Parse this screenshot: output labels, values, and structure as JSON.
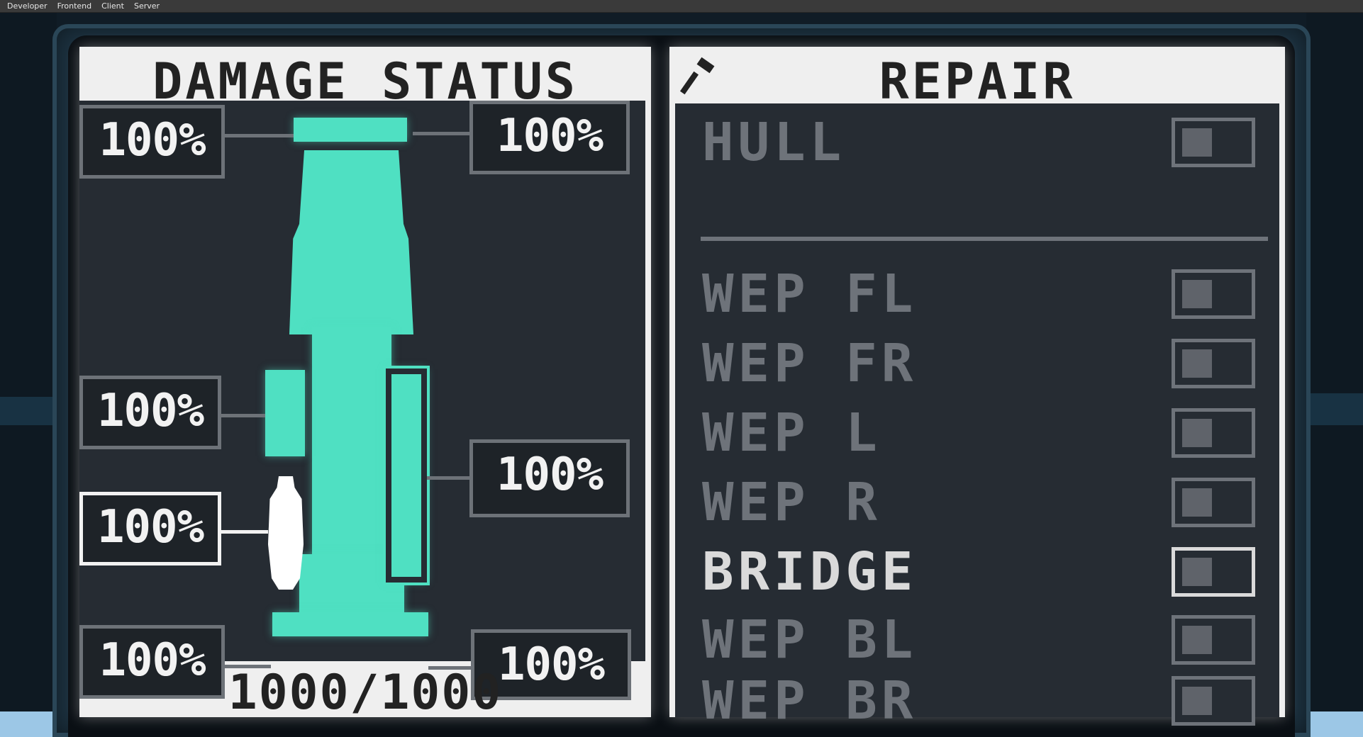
{
  "menu": [
    "Developer",
    "Frontend",
    "Client",
    "Server"
  ],
  "damage": {
    "title": "DAMAGE STATUS",
    "total": "1000/1000",
    "parts": {
      "top_left": "100%",
      "top_right": "100%",
      "mid_left": "100%",
      "selected_left": "100%",
      "mid_right": "100%",
      "bottom_left": "100%",
      "bottom_right": "100%"
    },
    "colors": {
      "hull": "#4fe0c2",
      "selected": "#ffffff"
    }
  },
  "repair": {
    "title": "REPAIR",
    "icon": "hammer-icon",
    "items": [
      {
        "label": "HULL",
        "active": false
      },
      {
        "label": "WEP FL",
        "active": false
      },
      {
        "label": "WEP FR",
        "active": false
      },
      {
        "label": "WEP L",
        "active": false
      },
      {
        "label": "WEP R",
        "active": false
      },
      {
        "label": "BRIDGE",
        "active": true
      },
      {
        "label": "WEP BL",
        "active": false
      },
      {
        "label": "WEP BR",
        "active": false
      }
    ]
  }
}
